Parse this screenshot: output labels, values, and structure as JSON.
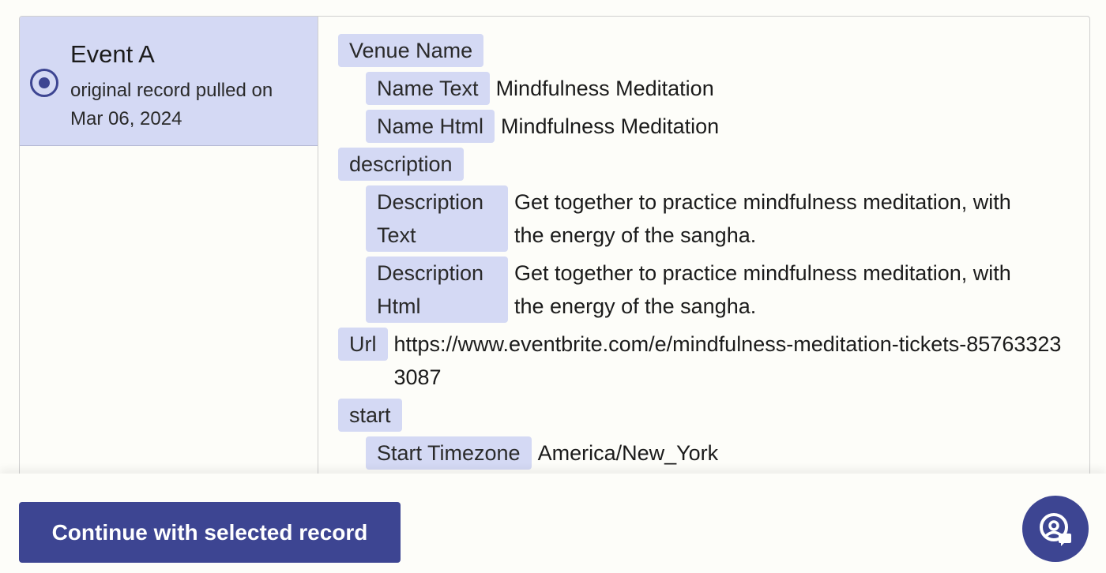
{
  "record": {
    "title": "Event A",
    "subtitle": "original record pulled on Mar 06, 2024",
    "selected": true
  },
  "fields": {
    "venue_name": {
      "label": "Venue Name"
    },
    "name_text": {
      "label": "Name Text",
      "value": "Mindfulness Meditation"
    },
    "name_html": {
      "label": "Name Html",
      "value": "Mindfulness Meditation"
    },
    "description": {
      "label": "description"
    },
    "description_text": {
      "label": "Description Text",
      "value": "Get together to practice mindfulness meditation, with the energy of the sangha."
    },
    "description_html": {
      "label": "Description Html",
      "value": "Get together to practice mindfulness meditation, with the energy of the sangha."
    },
    "url": {
      "label": "Url",
      "value": "https://www.eventbrite.com/e/mindfulness-meditation-tickets-857633233087"
    },
    "start": {
      "label": "start"
    },
    "start_timezone": {
      "label": "Start Timezone",
      "value": "America/New_York"
    }
  },
  "footer": {
    "continue_label": "Continue with selected record"
  },
  "colors": {
    "accent": "#3d4592",
    "key_bg": "#d4d9f4"
  },
  "icons": {
    "radio": "radio-selected-icon",
    "help": "support-chat-icon"
  }
}
